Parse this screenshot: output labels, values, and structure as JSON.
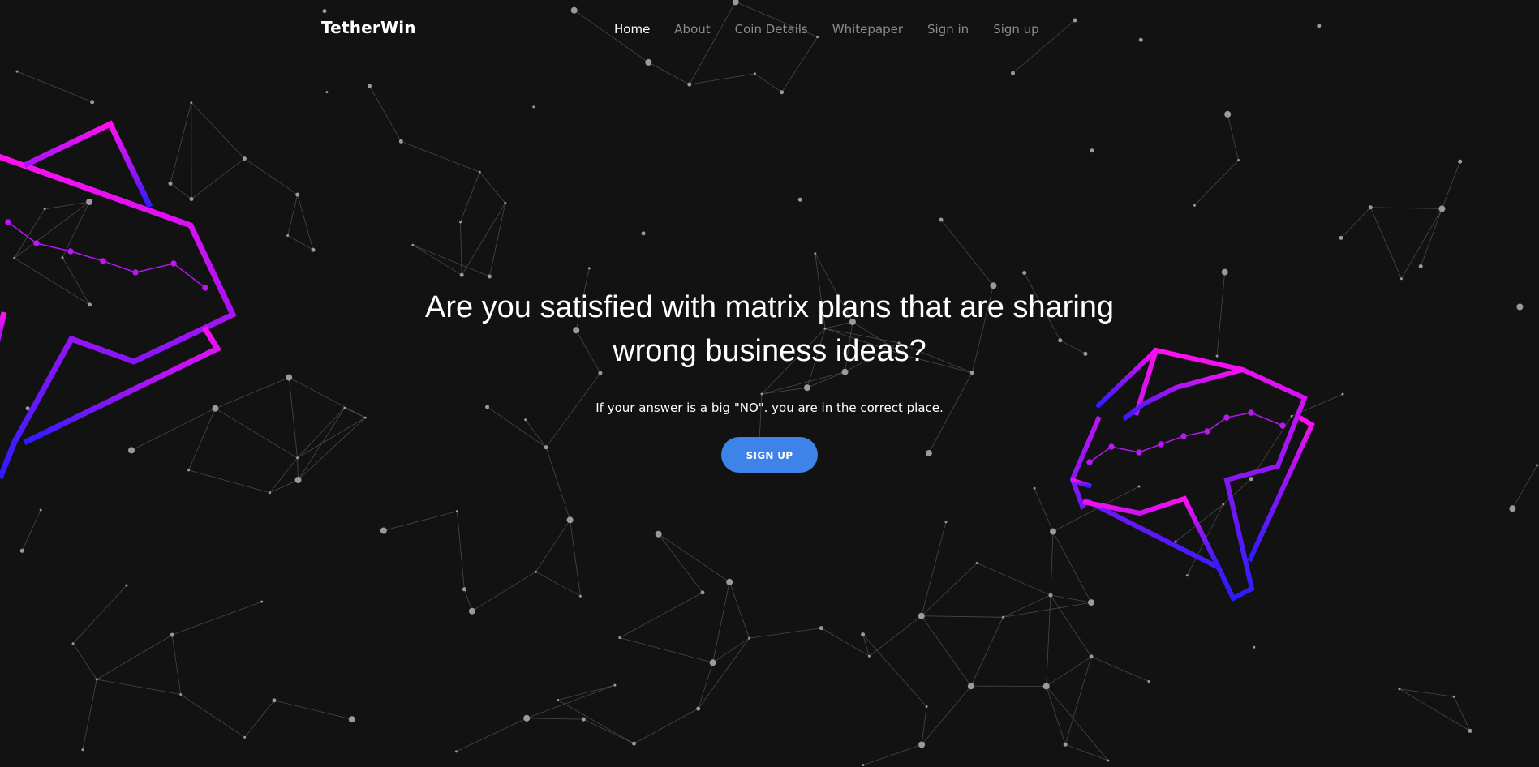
{
  "brand": {
    "name": "TetherWin"
  },
  "nav": {
    "items": [
      {
        "label": "Home",
        "active": true
      },
      {
        "label": "About",
        "active": false
      },
      {
        "label": "Coin Details",
        "active": false
      },
      {
        "label": "Whitepaper",
        "active": false
      },
      {
        "label": "Sign in",
        "active": false
      },
      {
        "label": "Sign up",
        "active": false
      }
    ]
  },
  "hero": {
    "title": "Are you satisfied with matrix plans that are sharing wrong business ideas?",
    "subtitle": "If your answer is a big \"NO\". you are in the correct place.",
    "cta_label": "SIGN UP"
  },
  "colors": {
    "background": "#121212",
    "accent_button": "#3e83e8",
    "logo_gradient_start": "#ff10f0",
    "logo_gradient_end": "#2a1cff",
    "nav_inactive": "#8c8c8c",
    "nav_active": "#ffffff"
  },
  "icons": {
    "background": "particle-network-graphic",
    "decorative_logo": "tetherwin-t-logo-icon"
  }
}
